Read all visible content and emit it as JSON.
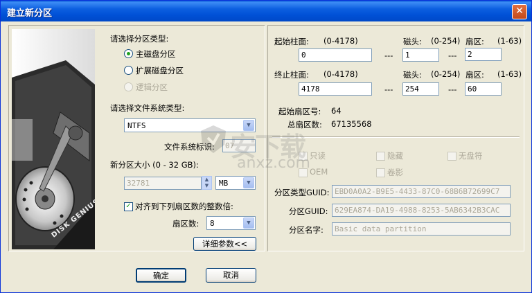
{
  "window": {
    "title": "建立新分区",
    "close_glyph": "✕"
  },
  "left": {
    "partition_type_label": "请选择分区类型:",
    "partition_types": [
      {
        "label": "主磁盘分区",
        "selected": true,
        "enabled": true
      },
      {
        "label": "扩展磁盘分区",
        "selected": false,
        "enabled": true
      },
      {
        "label": "逻辑分区",
        "selected": false,
        "enabled": false
      }
    ],
    "fs_type_label": "请选择文件系统类型:",
    "fs_type_value": "NTFS",
    "fs_id_label": "文件系统标识:",
    "fs_id_value": "07",
    "size_label": "新分区大小 (0 - 32 GB):",
    "size_value": "32781",
    "size_unit": "MB",
    "align_label": "对齐到下列扇区数的整数倍:",
    "align_checked": true,
    "sector_label": "扇区数:",
    "sector_value": "8",
    "detail_button": "详细参数<<",
    "disk_brand": "DISK GENIUS"
  },
  "right": {
    "start": {
      "cyl_label": "起始柱面:",
      "cyl_range": "(0-4178)",
      "cyl_value": "0",
      "head_label": "磁头:",
      "head_range": "(0-254)",
      "head_value": "1",
      "sector_label": "扇区:",
      "sector_range": "(1-63)",
      "sector_value": "2"
    },
    "end": {
      "cyl_label": "终止柱面:",
      "cyl_range": "(0-4178)",
      "cyl_value": "4178",
      "head_label": "磁头:",
      "head_range": "(0-254)",
      "head_value": "254",
      "sector_label": "扇区:",
      "sector_range": "(1-63)",
      "sector_value": "60"
    },
    "separator": "---",
    "start_sector_label": "起始扇区号:",
    "start_sector_value": "64",
    "total_sectors_label": "总扇区数:",
    "total_sectors_value": "67135568",
    "attrs": {
      "readonly": "只读",
      "hidden": "隐藏",
      "no_drive_letter": "无盘符",
      "oem": "OEM",
      "shadow": "卷影"
    },
    "type_guid_label": "分区类型GUID:",
    "type_guid_value": "EBD0A0A2-B9E5-4433-87C0-68B6B72699C7",
    "guid_label": "分区GUID:",
    "guid_value": "629EA874-DA19-4988-8253-5AB6342B3CAC",
    "name_label": "分区名字:",
    "name_value": "Basic data partition"
  },
  "footer": {
    "ok_label": "确定",
    "cancel_label": "取消"
  },
  "watermark": {
    "text": "安下载",
    "subtext": "anxz.com"
  },
  "colors": {
    "title_bar": "#0054e3",
    "dialog_bg": "#ece9d8",
    "radio_selected": "#21a121",
    "close_button": "#c44a1b"
  }
}
